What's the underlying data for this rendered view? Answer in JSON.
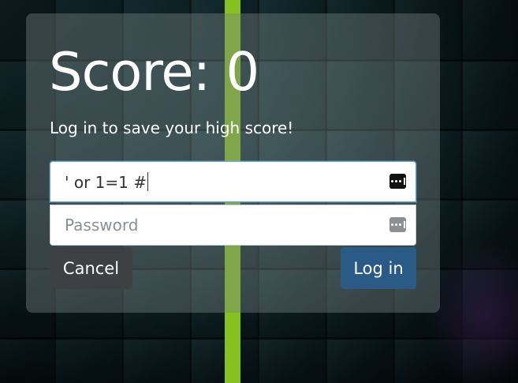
{
  "dialog": {
    "score_label": "Score: 0",
    "subtitle": "Log in to save your high score!"
  },
  "username_field": {
    "value": "' or 1=1 #",
    "icon": "password-manager-key-icon"
  },
  "password_field": {
    "placeholder": "Password",
    "icon": "password-manager-key-icon"
  },
  "buttons": {
    "cancel_label": "Cancel",
    "login_label": "Log in"
  },
  "colors": {
    "accent_bar": "#86c21f",
    "login_button": "#2a5b86",
    "cancel_button": "#3e4143"
  }
}
